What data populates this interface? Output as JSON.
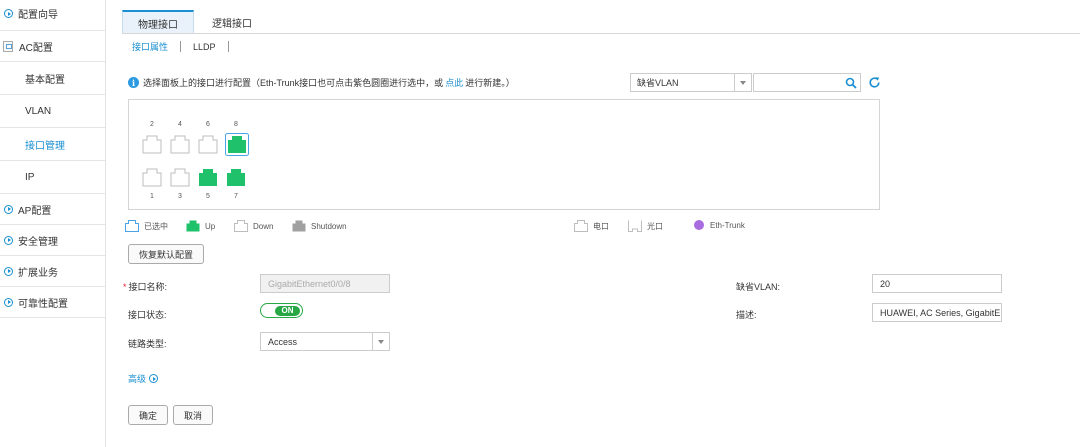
{
  "sidebar": {
    "items": [
      {
        "label": "配置向导"
      },
      {
        "label": "AC配置"
      },
      {
        "label": "基本配置"
      },
      {
        "label": "VLAN"
      },
      {
        "label": "接口管理"
      },
      {
        "label": "IP"
      },
      {
        "label": "AP配置"
      },
      {
        "label": "安全管理"
      },
      {
        "label": "扩展业务"
      },
      {
        "label": "可靠性配置"
      }
    ]
  },
  "tabs": [
    {
      "label": "物理接口"
    },
    {
      "label": "逻辑接口"
    }
  ],
  "subtabs": [
    {
      "label": "接口属性"
    },
    {
      "label": "LLDP"
    }
  ],
  "hint": {
    "icon": "i",
    "text_before": "选择面板上的接口进行配置（Eth-Trunk接口也可点击紫色圆圈进行选中，或",
    "link": "点此",
    "text_after": "进行新建。）"
  },
  "vlan_filter": {
    "selected": "缺省VLAN"
  },
  "search": {
    "value": ""
  },
  "ports": {
    "top": [
      {
        "num": "2",
        "state": "empty"
      },
      {
        "num": "4",
        "state": "empty"
      },
      {
        "num": "6",
        "state": "empty"
      },
      {
        "num": "8",
        "state": "up-selected"
      }
    ],
    "bottom": [
      {
        "num": "1",
        "state": "empty"
      },
      {
        "num": "3",
        "state": "empty"
      },
      {
        "num": "5",
        "state": "up"
      },
      {
        "num": "7",
        "state": "up"
      }
    ]
  },
  "legend": {
    "selected": "已选中",
    "up": "Up",
    "down": "Down",
    "shutdown": "Shutdown",
    "electrical": "电口",
    "optical": "光口",
    "eth_trunk": "Eth-Trunk"
  },
  "colors": {
    "accent": "#1a8fd1",
    "up": "#1fc26b",
    "shutdown": "#a0a0a0",
    "eth_trunk": "#a96be0"
  },
  "restore_button": "恢复默认配置",
  "form": {
    "port_name_label": "接口名称:",
    "port_name_value": "GigabitEthernet0/0/8",
    "port_status_label": "接口状态:",
    "port_status_value": "ON",
    "link_type_label": "链路类型:",
    "link_type_value": "Access",
    "default_vlan_label": "缺省VLAN:",
    "default_vlan_value": "20",
    "description_label": "描述:",
    "description_value": "HUAWEI, AC Series, GigabitE"
  },
  "advanced_label": "高级",
  "ok_button": "确定",
  "cancel_button": "取消"
}
